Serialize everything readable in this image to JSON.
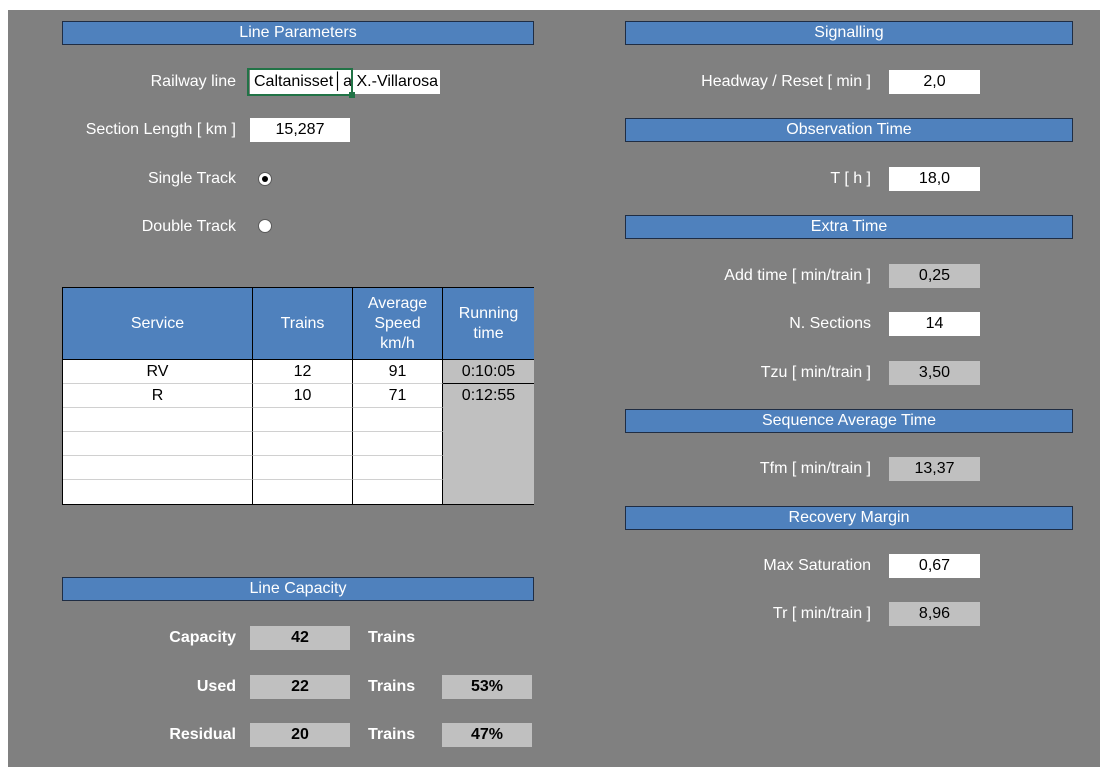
{
  "line_parameters": {
    "header": "Line Parameters",
    "railway_line_label": "Railway line",
    "railway_line_value": "Caltanisset│a X.-Villarosa",
    "section_length_label": "Section Length [ km ]",
    "section_length_value": "15,287",
    "single_track_label": "Single Track",
    "single_track_selected": true,
    "double_track_label": "Double Track",
    "double_track_selected": false
  },
  "service_table": {
    "headers": {
      "service": "Service",
      "trains": "Trains",
      "avg_speed_l1": "Average",
      "avg_speed_l2": "Speed",
      "avg_speed_l3": "km/h",
      "running_l1": "Running",
      "running_l2": "time"
    },
    "rows": [
      {
        "service": "RV",
        "trains": "12",
        "speed": "91",
        "running_time": "0:10:05"
      },
      {
        "service": "R",
        "trains": "10",
        "speed": "71",
        "running_time": "0:12:55"
      }
    ]
  },
  "line_capacity": {
    "header": "Line Capacity",
    "capacity_label": "Capacity",
    "capacity_value": "42",
    "capacity_unit": "Trains",
    "used_label": "Used",
    "used_value": "22",
    "used_unit": "Trains",
    "used_pct": "53%",
    "residual_label": "Residual",
    "residual_value": "20",
    "residual_unit": "Trains",
    "residual_pct": "47%"
  },
  "signalling": {
    "header": "Signalling",
    "headway_label": "Headway / Reset [ min ]",
    "headway_value": "2,0"
  },
  "observation_time": {
    "header": "Observation Time",
    "t_label": "T [ h ]",
    "t_value": "18,0"
  },
  "extra_time": {
    "header": "Extra Time",
    "add_time_label": "Add time [ min/train ]",
    "add_time_value": "0,25",
    "n_sections_label": "N. Sections",
    "n_sections_value": "14",
    "tzu_label": "Tzu [ min/train ]",
    "tzu_value": "3,50"
  },
  "sequence_average_time": {
    "header": "Sequence Average Time",
    "tfm_label": "Tfm [ min/train ]",
    "tfm_value": "13,37"
  },
  "recovery_margin": {
    "header": "Recovery Margin",
    "max_saturation_label": "Max Saturation",
    "max_saturation_value": "0,67",
    "tr_label": "Tr [ min/train ]",
    "tr_value": "8,96"
  },
  "colors": {
    "sheet_background": "#808080",
    "header_blue": "#4f81bd",
    "input_cell": "#ffffff",
    "computed_cell": "#c0c0c0",
    "selection_green": "#217346"
  }
}
